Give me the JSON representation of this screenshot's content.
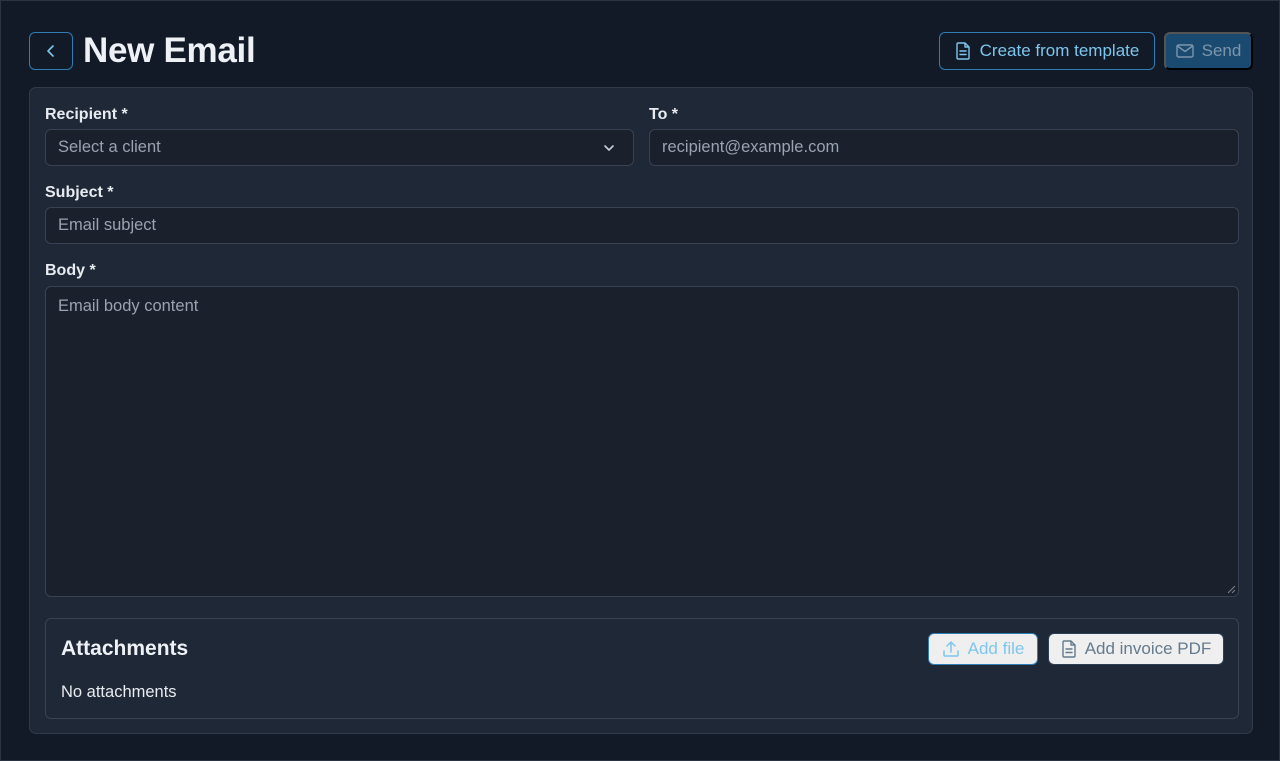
{
  "header": {
    "title": "New Email",
    "create_from_template_label": "Create from template",
    "send_label": "Send"
  },
  "form": {
    "recipient": {
      "label": "Recipient *",
      "placeholder": "Select a client"
    },
    "to": {
      "label": "To *",
      "placeholder": "recipient@example.com"
    },
    "subject": {
      "label": "Subject *",
      "placeholder": "Email subject"
    },
    "body": {
      "label": "Body *",
      "placeholder": "Email body content"
    }
  },
  "attachments": {
    "title": "Attachments",
    "add_file_label": "Add file",
    "add_invoice_pdf_label": "Add invoice PDF",
    "empty_text": "No attachments"
  },
  "icons": {
    "back": "chevron-left-icon",
    "template": "file-text-icon",
    "send": "mail-icon",
    "select": "chevron-down-icon",
    "upload": "upload-icon",
    "invoice": "file-text-icon"
  },
  "colors": {
    "background": "#131a27",
    "card": "#1f2837",
    "accent": "#7dc6ee",
    "accent_border": "#2e7db5",
    "send_bg": "#1b4a70"
  }
}
